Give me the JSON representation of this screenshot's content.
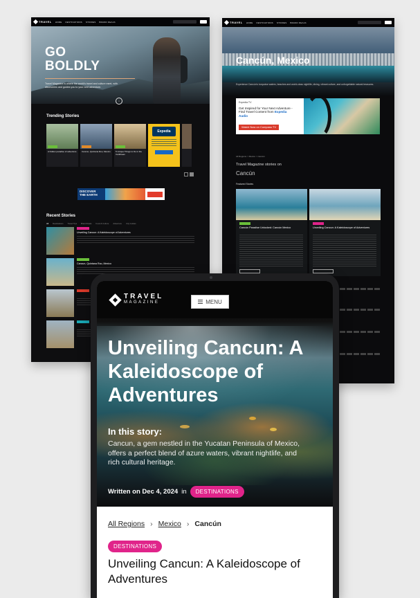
{
  "left_page": {
    "brand": "TRAVEL",
    "nav": [
      "HOME",
      "DESTINATIONS",
      "STORIES",
      "BRAND DEALS"
    ],
    "hero_title_l1": "GO",
    "hero_title_l2": "BOLDLY",
    "hero_desc": "Travel Magazine is where the world's travel and culture meet, with discoveries and guides you to your next adventure.",
    "trending_title": "Trending Stories",
    "trending_cards": [
      {
        "caption": "A hidden paradise of adventure",
        "color": "#7a9a6b"
      },
      {
        "caption": "Cancun, Quintana Roo, Mexico",
        "color": "#5a6f86"
      },
      {
        "caption": "5 Unique Things to Do in the Caribbean",
        "color": "#b19a6a"
      }
    ],
    "ad_brand": "Expedia",
    "banner_ad_l1": "DISCOVER",
    "banner_ad_l2": "THE EARTH",
    "recent_title": "Recent Stories",
    "recent_filters": [
      "All",
      "Destinations",
      "Travel Tips",
      "Brand Deals",
      "Food & Culture",
      "Adventure",
      "City Guides"
    ],
    "recent_items": [
      {
        "title": "Unveiling Cancun: A Kaleidoscope of Adventures",
        "badge": "#e0248a",
        "thumb": "#3a8fa0"
      },
      {
        "title": "Cancun, Quintana Roo, Mexico",
        "badge": "#6abf3a",
        "thumb": "#5fa0b3"
      },
      {
        "title": "",
        "badge": "#d93a2b",
        "thumb": "#9a8a6a"
      },
      {
        "title": "",
        "badge": "#1aa8b5",
        "thumb": "#8aa0b0"
      }
    ]
  },
  "right_page": {
    "hero_title": "Cancún, Mexico",
    "hero_desc": "Experience Cancún's turquoise waters, beaches and world-class nightlife, dining, vibrant culture, and unforgettable natural treasures.",
    "ad_small": "Expedia TV",
    "ad_line1": "Get Inspired for Your Next Adventure - Find Travel Content from ",
    "ad_link": "Expedia Audio",
    "ad_button": "Watch Now on Compass TV",
    "breadcrumbs": "All Regions  >  Mexico  >  Cancún",
    "stories_on": "Travel Magazine stories on",
    "place": "Cancún",
    "featured": "Featured Stories",
    "cards": [
      {
        "title": "Cancún Paradise Unlocked: Cancún Mexico",
        "color": "#3b7fa0"
      },
      {
        "title": "Unveiling Cancun: A Kaleidoscope of Adventures",
        "color": "#7fa6b8"
      }
    ]
  },
  "tablet": {
    "brand_l1": "TRAVEL",
    "brand_l2": "MAGAZINE",
    "menu_label": "MENU",
    "title": "Unveiling Cancun: A Kaleidoscope of Adventures",
    "story_label": "In this story:",
    "story_text": "Cancun, a gem nestled in the Yucatan Peninsula of Mexico, offers a perfect blend of azure waters, vibrant nightlife, and rich cultural heritage.",
    "written_on": "Written on Dec 4, 2024",
    "in_word": "in",
    "category": "DESTINATIONS",
    "crumbs": [
      "All Regions",
      "Mexico",
      "Cancún"
    ],
    "crumb_sep": "›",
    "category2": "DESTINATIONS",
    "subtitle": "Unveiling Cancun: A Kaleidoscope of Adventures"
  }
}
